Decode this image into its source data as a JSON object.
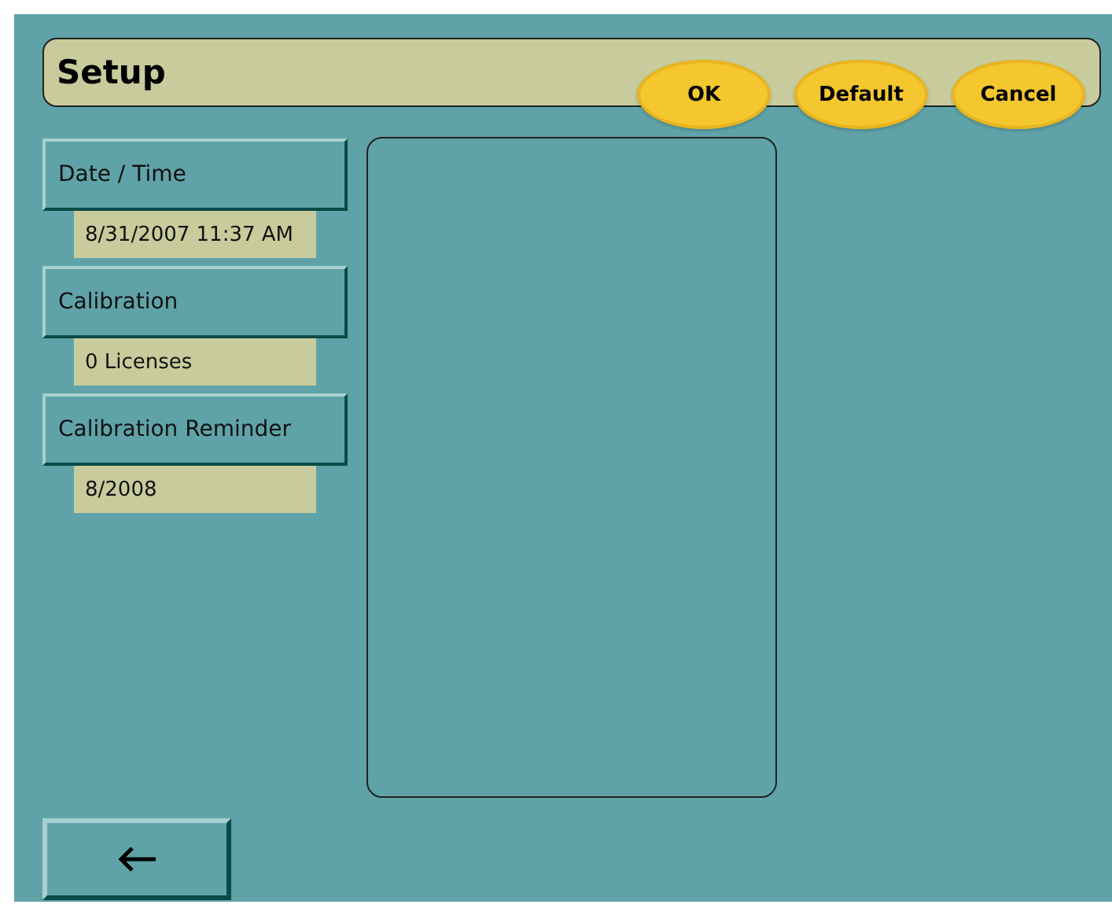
{
  "window": {
    "title": "Setup"
  },
  "buttons": [
    "OK",
    "Default",
    "Cancel"
  ],
  "settings": [
    {
      "label": "Date / Time",
      "value": "8/31/2007 11:37 AM"
    },
    {
      "label": "Calibration",
      "value": "0 Licenses"
    },
    {
      "label": "Calibration Reminder",
      "value": "8/2008"
    }
  ]
}
